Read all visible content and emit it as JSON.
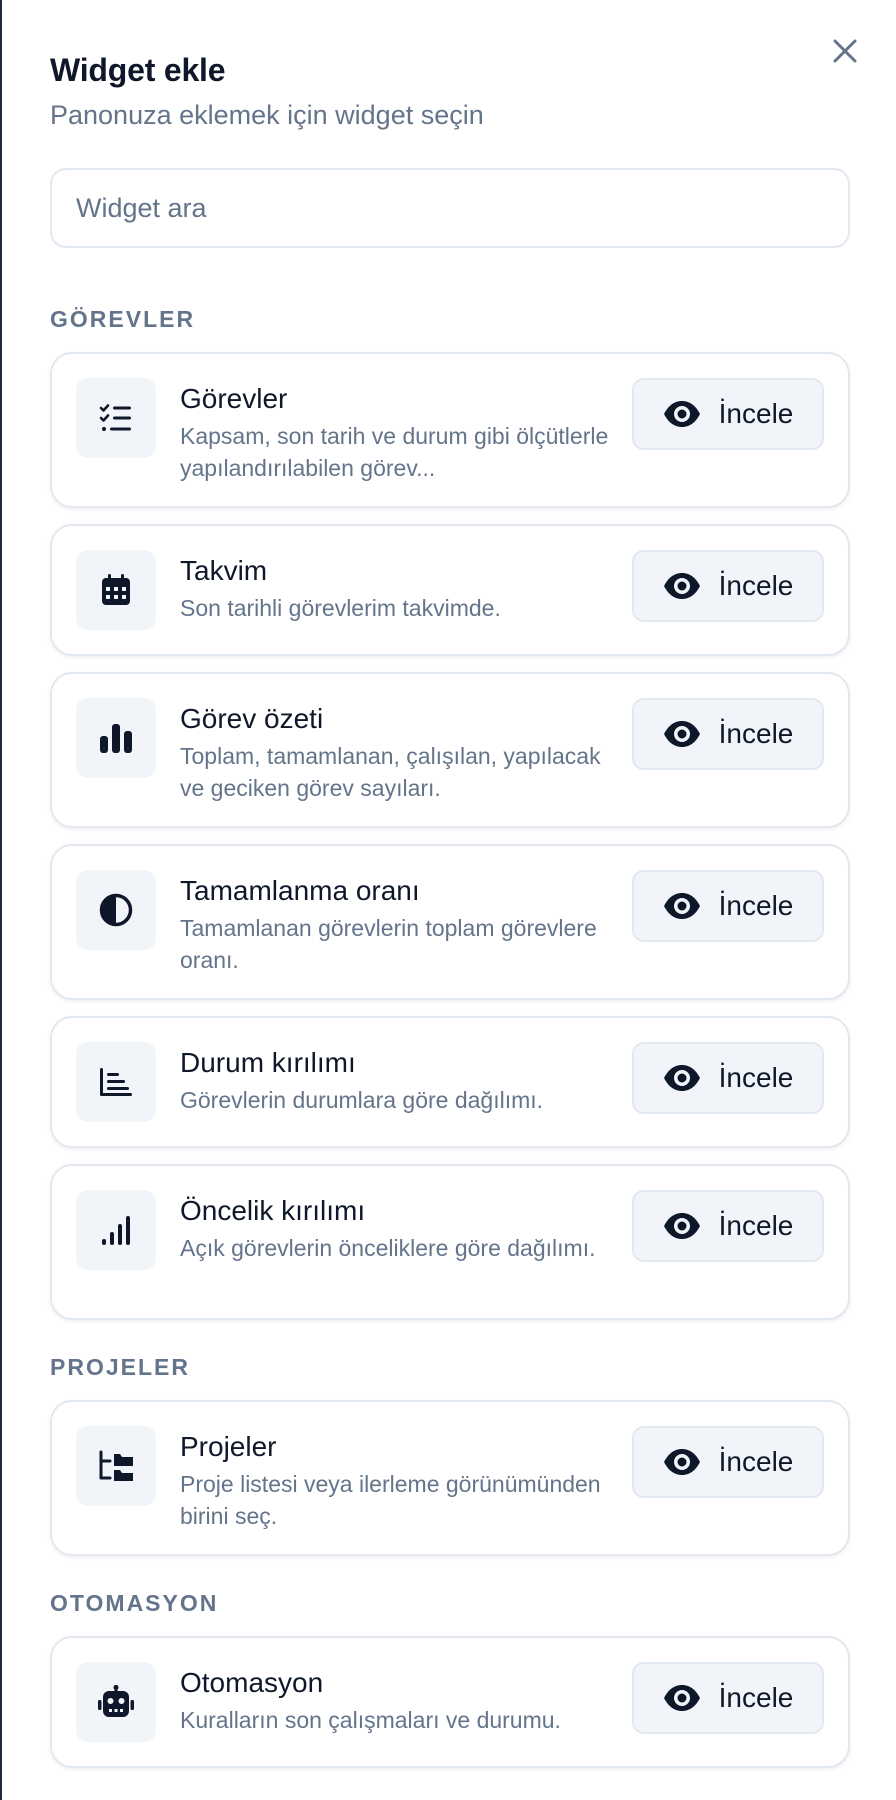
{
  "header": {
    "title": "Widget ekle",
    "subtitle": "Panonuza eklemek için widget seçin",
    "close_icon": "close-icon"
  },
  "search": {
    "placeholder": "Widget ara",
    "value": ""
  },
  "sections": [
    {
      "title": "GÖREVLER",
      "items": [
        {
          "name": "Görevler",
          "description": "Kapsam, son tarih ve durum gibi ölçütlerle yapılandırılabilen görev...",
          "icon": "list-check-icon",
          "button": "İncele"
        },
        {
          "name": "Takvim",
          "description": "Son tarihli görevlerim takvimde.",
          "icon": "calendar-icon",
          "button": "İncele"
        },
        {
          "name": "Görev özeti",
          "description": "Toplam, tamamlanan, çalışılan, yapılacak ve geciken görev sayıları.",
          "icon": "bar-chart-icon",
          "button": "İncele"
        },
        {
          "name": "Tamamlanma oranı",
          "description": "Tamamlanan görevlerin toplam görevlere oranı.",
          "icon": "half-circle-icon",
          "button": "İncele"
        },
        {
          "name": "Durum kırılımı",
          "description": "Görevlerin durumlara göre dağılımı.",
          "icon": "horizontal-bars-icon",
          "button": "İncele"
        },
        {
          "name": "Öncelik kırılımı",
          "description": "Açık görevlerin önceliklere göre dağılımı.",
          "icon": "signal-bars-icon",
          "button": "İncele"
        }
      ]
    },
    {
      "title": "PROJELER",
      "items": [
        {
          "name": "Projeler",
          "description": "Proje listesi veya ilerleme görünümünden birini seç.",
          "icon": "folder-tree-icon",
          "button": "İncele"
        }
      ]
    },
    {
      "title": "OTOMASYON",
      "items": [
        {
          "name": "Otomasyon",
          "description": "Kuralların son çalışmaları ve durumu.",
          "icon": "robot-icon",
          "button": "İncele"
        }
      ]
    }
  ],
  "colors": {
    "text_primary": "#0f172a",
    "text_muted": "#64748b",
    "border": "#e2e8f0",
    "icon_bg": "#f1f5f9"
  }
}
